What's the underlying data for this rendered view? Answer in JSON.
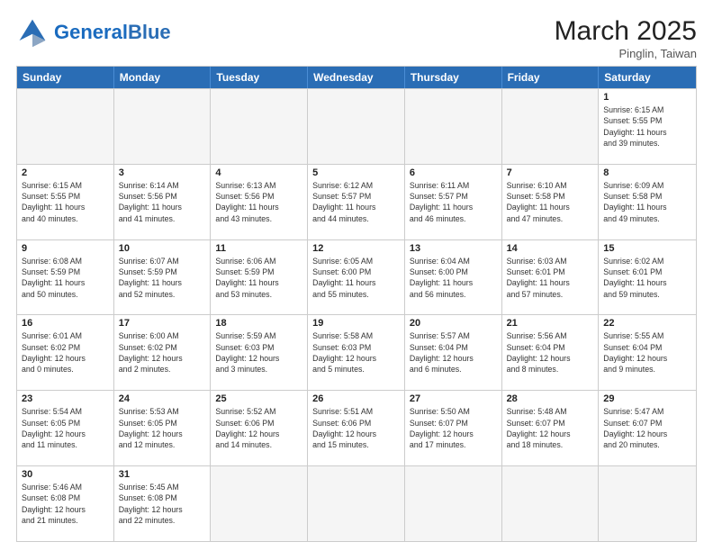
{
  "header": {
    "logo_general": "General",
    "logo_blue": "Blue",
    "month": "March 2025",
    "location": "Pinglin, Taiwan"
  },
  "weekdays": [
    "Sunday",
    "Monday",
    "Tuesday",
    "Wednesday",
    "Thursday",
    "Friday",
    "Saturday"
  ],
  "rows": [
    [
      {
        "day": "",
        "info": ""
      },
      {
        "day": "",
        "info": ""
      },
      {
        "day": "",
        "info": ""
      },
      {
        "day": "",
        "info": ""
      },
      {
        "day": "",
        "info": ""
      },
      {
        "day": "",
        "info": ""
      },
      {
        "day": "1",
        "info": "Sunrise: 6:15 AM\nSunset: 5:55 PM\nDaylight: 11 hours\nand 39 minutes."
      }
    ],
    [
      {
        "day": "2",
        "info": "Sunrise: 6:15 AM\nSunset: 5:55 PM\nDaylight: 11 hours\nand 40 minutes."
      },
      {
        "day": "3",
        "info": "Sunrise: 6:14 AM\nSunset: 5:56 PM\nDaylight: 11 hours\nand 41 minutes."
      },
      {
        "day": "4",
        "info": "Sunrise: 6:13 AM\nSunset: 5:56 PM\nDaylight: 11 hours\nand 43 minutes."
      },
      {
        "day": "5",
        "info": "Sunrise: 6:12 AM\nSunset: 5:57 PM\nDaylight: 11 hours\nand 44 minutes."
      },
      {
        "day": "6",
        "info": "Sunrise: 6:11 AM\nSunset: 5:57 PM\nDaylight: 11 hours\nand 46 minutes."
      },
      {
        "day": "7",
        "info": "Sunrise: 6:10 AM\nSunset: 5:58 PM\nDaylight: 11 hours\nand 47 minutes."
      },
      {
        "day": "8",
        "info": "Sunrise: 6:09 AM\nSunset: 5:58 PM\nDaylight: 11 hours\nand 49 minutes."
      }
    ],
    [
      {
        "day": "9",
        "info": "Sunrise: 6:08 AM\nSunset: 5:59 PM\nDaylight: 11 hours\nand 50 minutes."
      },
      {
        "day": "10",
        "info": "Sunrise: 6:07 AM\nSunset: 5:59 PM\nDaylight: 11 hours\nand 52 minutes."
      },
      {
        "day": "11",
        "info": "Sunrise: 6:06 AM\nSunset: 5:59 PM\nDaylight: 11 hours\nand 53 minutes."
      },
      {
        "day": "12",
        "info": "Sunrise: 6:05 AM\nSunset: 6:00 PM\nDaylight: 11 hours\nand 55 minutes."
      },
      {
        "day": "13",
        "info": "Sunrise: 6:04 AM\nSunset: 6:00 PM\nDaylight: 11 hours\nand 56 minutes."
      },
      {
        "day": "14",
        "info": "Sunrise: 6:03 AM\nSunset: 6:01 PM\nDaylight: 11 hours\nand 57 minutes."
      },
      {
        "day": "15",
        "info": "Sunrise: 6:02 AM\nSunset: 6:01 PM\nDaylight: 11 hours\nand 59 minutes."
      }
    ],
    [
      {
        "day": "16",
        "info": "Sunrise: 6:01 AM\nSunset: 6:02 PM\nDaylight: 12 hours\nand 0 minutes."
      },
      {
        "day": "17",
        "info": "Sunrise: 6:00 AM\nSunset: 6:02 PM\nDaylight: 12 hours\nand 2 minutes."
      },
      {
        "day": "18",
        "info": "Sunrise: 5:59 AM\nSunset: 6:03 PM\nDaylight: 12 hours\nand 3 minutes."
      },
      {
        "day": "19",
        "info": "Sunrise: 5:58 AM\nSunset: 6:03 PM\nDaylight: 12 hours\nand 5 minutes."
      },
      {
        "day": "20",
        "info": "Sunrise: 5:57 AM\nSunset: 6:04 PM\nDaylight: 12 hours\nand 6 minutes."
      },
      {
        "day": "21",
        "info": "Sunrise: 5:56 AM\nSunset: 6:04 PM\nDaylight: 12 hours\nand 8 minutes."
      },
      {
        "day": "22",
        "info": "Sunrise: 5:55 AM\nSunset: 6:04 PM\nDaylight: 12 hours\nand 9 minutes."
      }
    ],
    [
      {
        "day": "23",
        "info": "Sunrise: 5:54 AM\nSunset: 6:05 PM\nDaylight: 12 hours\nand 11 minutes."
      },
      {
        "day": "24",
        "info": "Sunrise: 5:53 AM\nSunset: 6:05 PM\nDaylight: 12 hours\nand 12 minutes."
      },
      {
        "day": "25",
        "info": "Sunrise: 5:52 AM\nSunset: 6:06 PM\nDaylight: 12 hours\nand 14 minutes."
      },
      {
        "day": "26",
        "info": "Sunrise: 5:51 AM\nSunset: 6:06 PM\nDaylight: 12 hours\nand 15 minutes."
      },
      {
        "day": "27",
        "info": "Sunrise: 5:50 AM\nSunset: 6:07 PM\nDaylight: 12 hours\nand 17 minutes."
      },
      {
        "day": "28",
        "info": "Sunrise: 5:48 AM\nSunset: 6:07 PM\nDaylight: 12 hours\nand 18 minutes."
      },
      {
        "day": "29",
        "info": "Sunrise: 5:47 AM\nSunset: 6:07 PM\nDaylight: 12 hours\nand 20 minutes."
      }
    ],
    [
      {
        "day": "30",
        "info": "Sunrise: 5:46 AM\nSunset: 6:08 PM\nDaylight: 12 hours\nand 21 minutes."
      },
      {
        "day": "31",
        "info": "Sunrise: 5:45 AM\nSunset: 6:08 PM\nDaylight: 12 hours\nand 22 minutes."
      },
      {
        "day": "",
        "info": ""
      },
      {
        "day": "",
        "info": ""
      },
      {
        "day": "",
        "info": ""
      },
      {
        "day": "",
        "info": ""
      },
      {
        "day": "",
        "info": ""
      }
    ]
  ]
}
